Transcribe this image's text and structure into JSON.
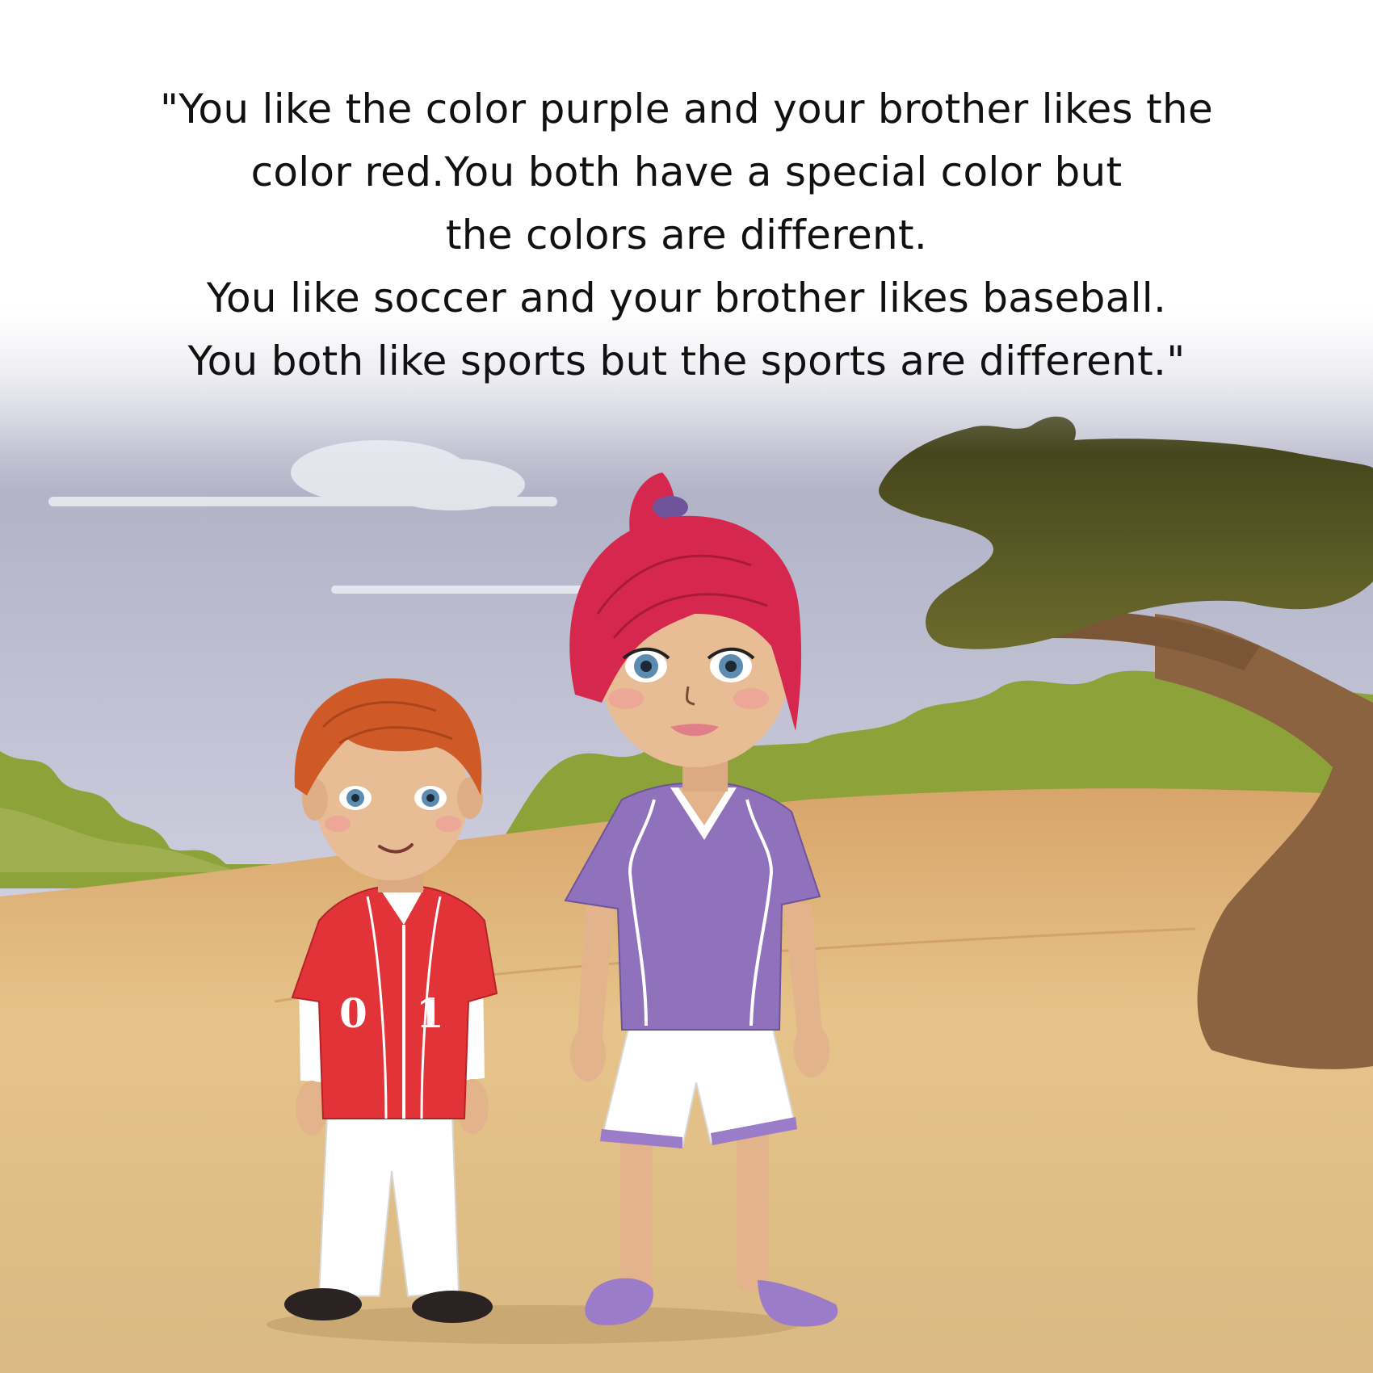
{
  "story": {
    "lines": [
      "\"You like the color purple and your brother likes the",
      "color red.You both have a special color but",
      "the colors are different.",
      "You like soccer and your brother likes baseball.",
      "You both like sports but the sports are different.\""
    ]
  },
  "illustration": {
    "boy_jersey_numbers": [
      "0",
      "1"
    ],
    "colors": {
      "sky": "#d4d4e4",
      "ground": "#dcb578",
      "bush": "#8ea23a",
      "tree_canopy": "#5a5a25",
      "tree_trunk": "#8b6340",
      "boy_jersey": "#e23438",
      "girl_shirt": "#8f72bb",
      "girl_hair": "#d6284e",
      "boy_hair": "#cf5a28"
    }
  }
}
